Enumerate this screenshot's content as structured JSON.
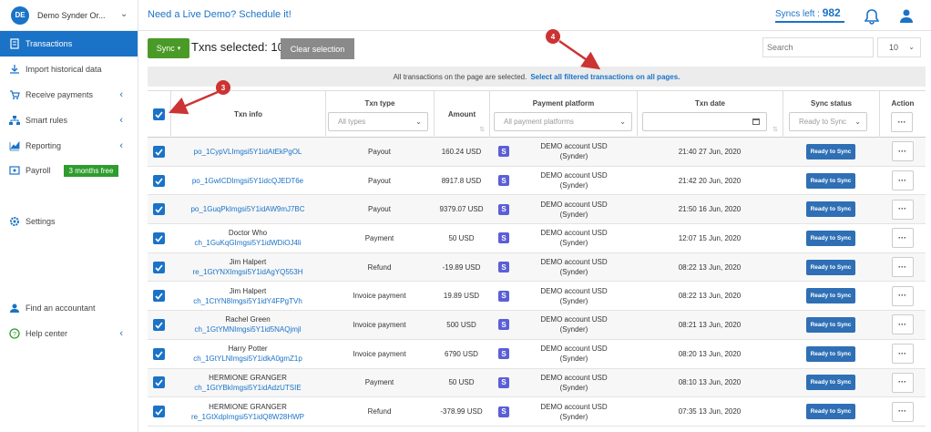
{
  "org": {
    "initials": "DE",
    "name": "Demo Synder Or..."
  },
  "nav": {
    "transactions": "Transactions",
    "import": "Import historical data",
    "receive": "Receive payments",
    "smart": "Smart rules",
    "reporting": "Reporting",
    "payroll": "Payroll",
    "payroll_badge": "3 months free",
    "settings": "Settings",
    "accountant": "Find an accountant",
    "help": "Help center"
  },
  "header": {
    "demo_link": "Need a Live Demo? Schedule it!",
    "syncs_label": "Syncs left :",
    "syncs_value": "982"
  },
  "toolbar": {
    "sync_label": "Sync",
    "txns_selected": "Txns selected: 10",
    "clear_label": "Clear selection",
    "search_placeholder": "Search",
    "per_page": "10"
  },
  "banner": {
    "text": "All transactions on the page are selected.",
    "link": "Select all filtered transactions on all pages."
  },
  "columns": {
    "txn_info": "Txn info",
    "txn_type": "Txn type",
    "txn_type_filter": "All types",
    "amount": "Amount",
    "platform": "Payment platform",
    "platform_filter": "All payment platforms",
    "date": "Txn date",
    "status": "Sync status",
    "status_filter": "Ready to Sync",
    "action": "Action"
  },
  "rows": [
    {
      "name": "",
      "id": "po_1CypVLImgsi5Y1idAtEkPgOL",
      "type": "Payout",
      "amount": "160.24 USD",
      "platform1": "DEMO account USD",
      "platform2": "(Synder)",
      "date": "21:40 27 Jun, 2020",
      "status": "Ready to Sync"
    },
    {
      "name": "",
      "id": "po_1GwICDImgsi5Y1idcQJEDT6e",
      "type": "Payout",
      "amount": "8917.8 USD",
      "platform1": "DEMO account USD",
      "platform2": "(Synder)",
      "date": "21:42 20 Jun, 2020",
      "status": "Ready to Sync"
    },
    {
      "name": "",
      "id": "po_1GuqPkImgsi5Y1idAW9mJ7BC",
      "type": "Payout",
      "amount": "9379.07 USD",
      "platform1": "DEMO account USD",
      "platform2": "(Synder)",
      "date": "21:50 16 Jun, 2020",
      "status": "Ready to Sync"
    },
    {
      "name": "Doctor Who",
      "id": "ch_1GuKqGImgsi5Y1idWDiOJ4li",
      "type": "Payment",
      "amount": "50 USD",
      "platform1": "DEMO account USD",
      "platform2": "(Synder)",
      "date": "12:07 15 Jun, 2020",
      "status": "Ready to Sync"
    },
    {
      "name": "Jim Halpert",
      "id": "re_1GtYNXImgsi5Y1idAgYQ553H",
      "type": "Refund",
      "amount": "-19.89 USD",
      "platform1": "DEMO account USD",
      "platform2": "(Synder)",
      "date": "08:22 13 Jun, 2020",
      "status": "Ready to Sync"
    },
    {
      "name": "Jim Halpert",
      "id": "ch_1CtYN8Imgsi5Y1idY4FPgTVh",
      "type": "Invoice payment",
      "amount": "19.89 USD",
      "platform1": "DEMO account USD",
      "platform2": "(Synder)",
      "date": "08:22 13 Jun, 2020",
      "status": "Ready to Sync"
    },
    {
      "name": "Rachel Green",
      "id": "ch_1GtYMNImgsi5Y1id5NAQjmjl",
      "type": "Invoice payment",
      "amount": "500 USD",
      "platform1": "DEMO account USD",
      "platform2": "(Synder)",
      "date": "08:21 13 Jun, 2020",
      "status": "Ready to Sync"
    },
    {
      "name": "Harry Potter",
      "id": "ch_1GtYLNImgsi5Y1idkA0gmZ1p",
      "type": "Invoice payment",
      "amount": "6790 USD",
      "platform1": "DEMO account USD",
      "platform2": "(Synder)",
      "date": "08:20 13 Jun, 2020",
      "status": "Ready to Sync"
    },
    {
      "name": "HERMIONE GRANGER",
      "id": "ch_1GtYBkImgsi5Y1idAdzUTSIE",
      "type": "Payment",
      "amount": "50 USD",
      "platform1": "DEMO account USD",
      "platform2": "(Synder)",
      "date": "08:10 13 Jun, 2020",
      "status": "Ready to Sync"
    },
    {
      "name": "HERMIONE GRANGER",
      "id": "re_1GtXdpImgsi5Y1idQ8W28HWP",
      "type": "Refund",
      "amount": "-378.99 USD",
      "platform1": "DEMO account USD",
      "platform2": "(Synder)",
      "date": "07:35 13 Jun, 2020",
      "status": "Ready to Sync"
    }
  ],
  "callouts": {
    "three": "3",
    "four": "4"
  },
  "colors": {
    "primary": "#1a73c7",
    "sync_green": "#4a9a27",
    "callout_red": "#cc3333"
  }
}
